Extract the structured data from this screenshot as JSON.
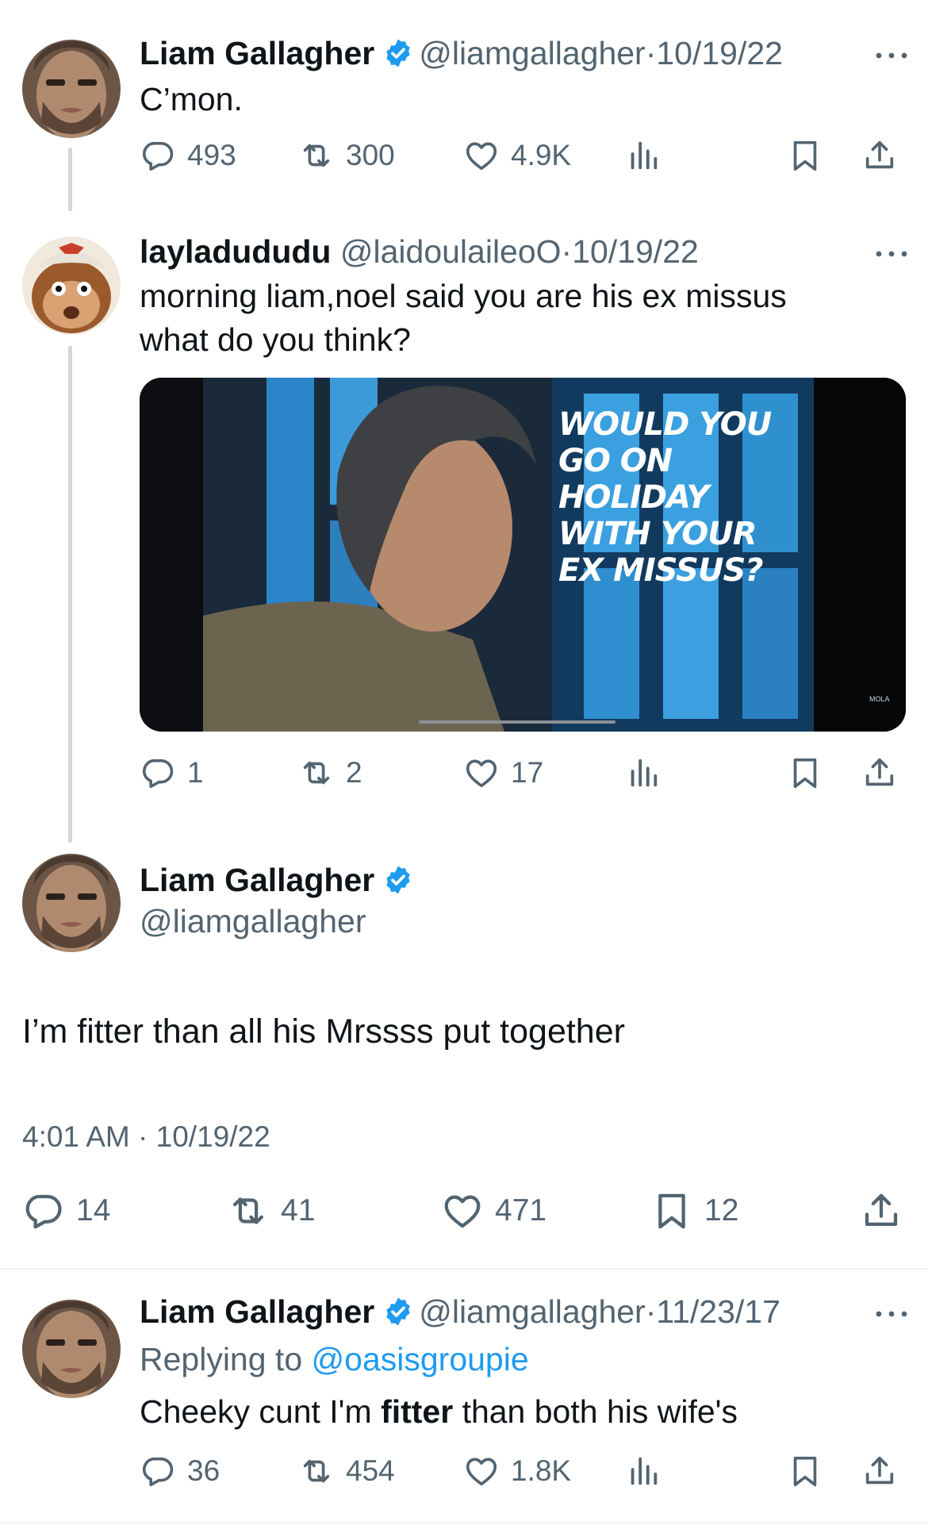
{
  "colors": {
    "accent": "#1d9bf0",
    "secondary_text": "#536471",
    "primary_text": "#0f1419",
    "line": "#cfd9de"
  },
  "tweets": [
    {
      "name": "Liam Gallagher",
      "verified": true,
      "handle": "@liamgallagher",
      "sep": "·",
      "date": "10/19/22",
      "text": "C’mon.",
      "replies": "493",
      "reposts": "300",
      "likes": "4.9K"
    },
    {
      "name": "layladududu",
      "verified": false,
      "handle": "@laidoulaileoO",
      "sep": "·",
      "date": "10/19/22",
      "text_line1": "morning liam,noel said you are his ex missus",
      "text_line2": "what do you think?",
      "media_caption": [
        "WOULD YOU",
        "GO ON",
        "HOLIDAY",
        "WITH YOUR",
        "EX MISSUS?"
      ],
      "media_watermark": "MOLA",
      "replies": "1",
      "reposts": "2",
      "likes": "17"
    }
  ],
  "focused": {
    "name": "Liam Gallagher",
    "verified": true,
    "handle": "@liamgallagher",
    "text": "I’m fitter than all his Mrssss put together",
    "time": "4:01 AM",
    "sep": "·",
    "date": "10/19/22",
    "replies": "14",
    "reposts": "41",
    "likes": "471",
    "bookmarks": "12"
  },
  "reply": {
    "name": "Liam Gallagher",
    "verified": true,
    "handle": "@liamgallagher",
    "sep": "·",
    "date": "11/23/17",
    "replying_to_label": "Replying to",
    "replying_to_handle": "@oasisgroupie",
    "text_before": "Cheeky cunt I'm ",
    "text_bold": "fitter",
    "text_after": " than both his wife's",
    "replies": "36",
    "reposts": "454",
    "likes": "1.8K"
  }
}
